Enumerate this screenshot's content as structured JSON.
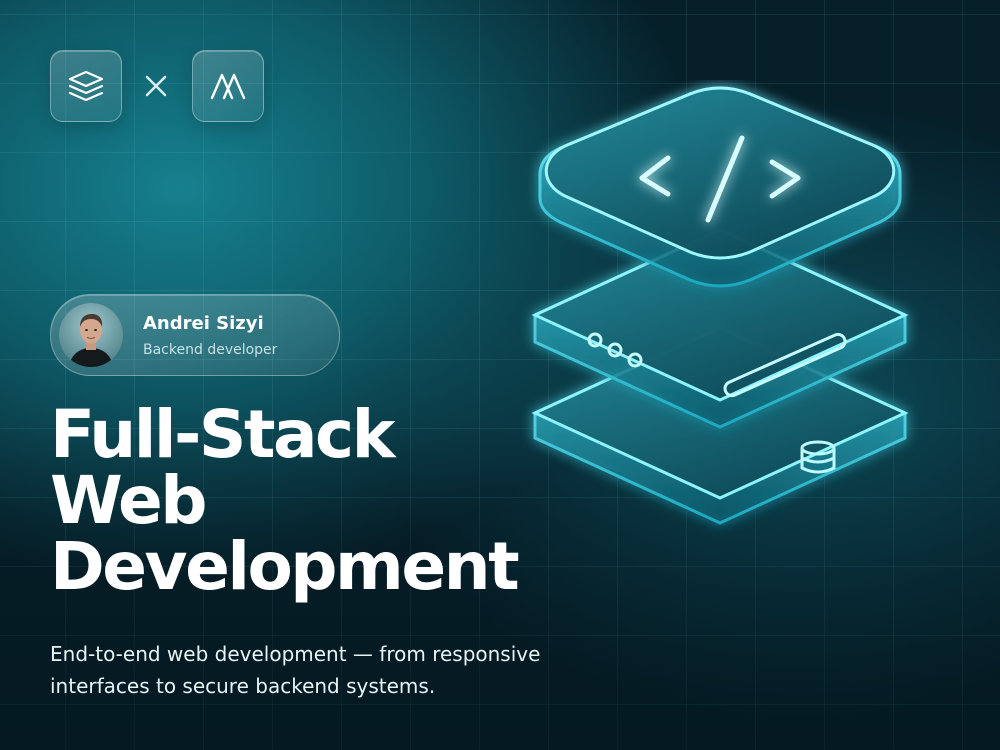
{
  "header": {
    "left_logo_icon": "layers-icon",
    "separator_icon": "times-icon",
    "right_logo_icon": "mountain-logo-icon"
  },
  "profile": {
    "name": "Andrei Sizyi",
    "role": "Backend developer",
    "avatar_icon": "person-avatar"
  },
  "headline": {
    "line1": "Full-Stack",
    "line2": "Web",
    "line3": "Development"
  },
  "subtitle": {
    "line1": "End-to-end web development — from responsive",
    "line2": "interfaces to secure backend systems."
  },
  "illustration": {
    "icon": "server-stack-code-icon",
    "top_symbol": "</>"
  },
  "colors": {
    "background": "#061f29",
    "accent": "#5fe6f5",
    "text": "#ffffff"
  }
}
